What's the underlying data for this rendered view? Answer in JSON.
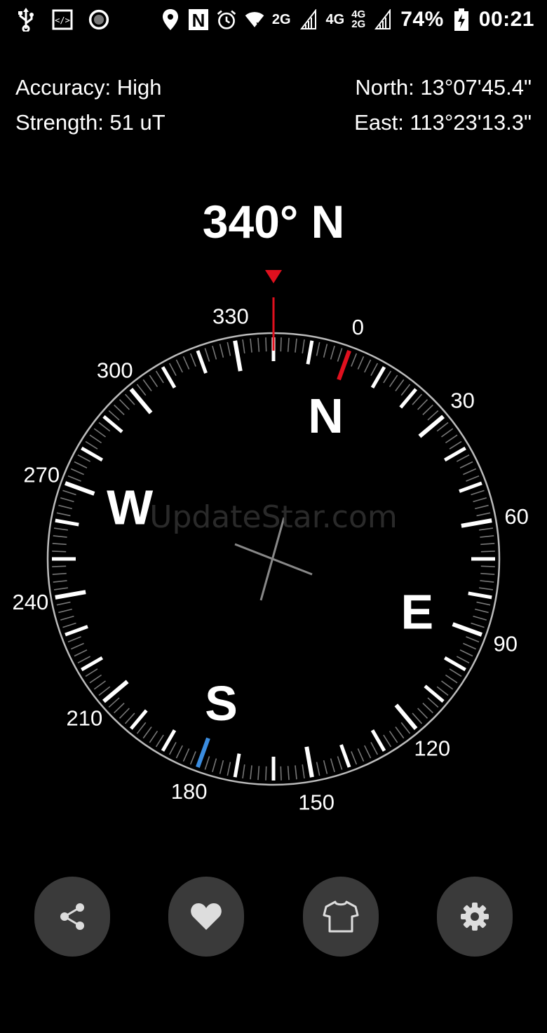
{
  "status_bar": {
    "battery_percent": "74%",
    "time": "00:21",
    "network_2g": "2G",
    "network_4g": "4G",
    "network_4g_2g_top": "4G",
    "network_4g_2g_bottom": "2G",
    "icons_left": [
      "usb-icon",
      "developer-icon",
      "record-icon"
    ],
    "icons_right": [
      "location-icon",
      "nfc-icon",
      "alarm-icon",
      "wifi-icon",
      "signal-icon",
      "battery-charging-icon"
    ]
  },
  "info": {
    "accuracy": "Accuracy: High",
    "strength": "Strength: 51 uT",
    "north": "North: 13°07'45.4\"",
    "east": "East: 113°23'13.3\""
  },
  "heading": "340° N",
  "compass": {
    "rotation_deg": 20,
    "degree_labels": [
      "0",
      "30",
      "60",
      "90",
      "120",
      "150",
      "180",
      "210",
      "240",
      "270",
      "300",
      "330"
    ],
    "cardinals": [
      {
        "label": "N",
        "deg": 0
      },
      {
        "label": "E",
        "deg": 90
      },
      {
        "label": "S",
        "deg": 180
      },
      {
        "label": "W",
        "deg": 270
      }
    ],
    "north_marker_color": "#e0101e",
    "south_marker_color": "#3b8de0",
    "pointer_color": "#e0101e"
  },
  "watermark": "UpdateStar.com",
  "toolbar": {
    "buttons": [
      "share-icon",
      "heart-icon",
      "shirt-icon",
      "gear-icon"
    ]
  }
}
